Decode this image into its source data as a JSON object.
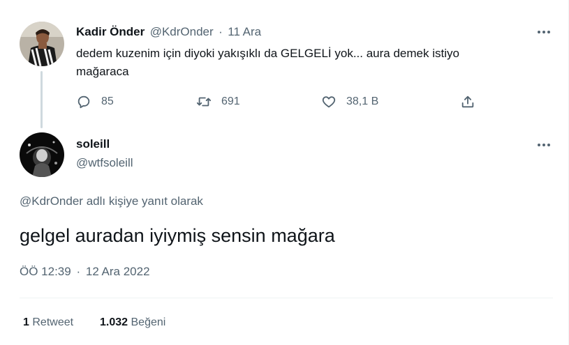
{
  "parent_tweet": {
    "author_name": "Kadir Önder",
    "handle": "@KdrOnder",
    "separator": "·",
    "date": "11 Ara",
    "text_line1": "dedem kuzenim için diyoki yakışıklı da GELGELİ yok... aura demek istiyo",
    "text_line2": "mağaraca",
    "replies": "85",
    "retweets": "691",
    "likes": "38,1 B"
  },
  "reply_tweet": {
    "author_name": "soleill",
    "handle": "@wtfsoleill",
    "reply_to_handle": "@KdrOnder",
    "reply_to_suffix": " adlı kişiye yanıt olarak",
    "text": "gelgel auradan iyiymiş sensin mağara",
    "time": "ÖÖ 12:39",
    "separator": "·",
    "date": "12 Ara 2022",
    "retweet_count": "1",
    "retweet_label": "Retweet",
    "like_count": "1.032",
    "like_label": "Beğeni"
  },
  "icons": {
    "reply": "reply-icon",
    "retweet": "retweet-icon",
    "like": "heart-icon",
    "share": "share-icon",
    "more": "more-icon"
  },
  "colors": {
    "text": "#0f1419",
    "muted": "#536471",
    "link": "#1d9bf0",
    "divider": "#eff3f4"
  }
}
